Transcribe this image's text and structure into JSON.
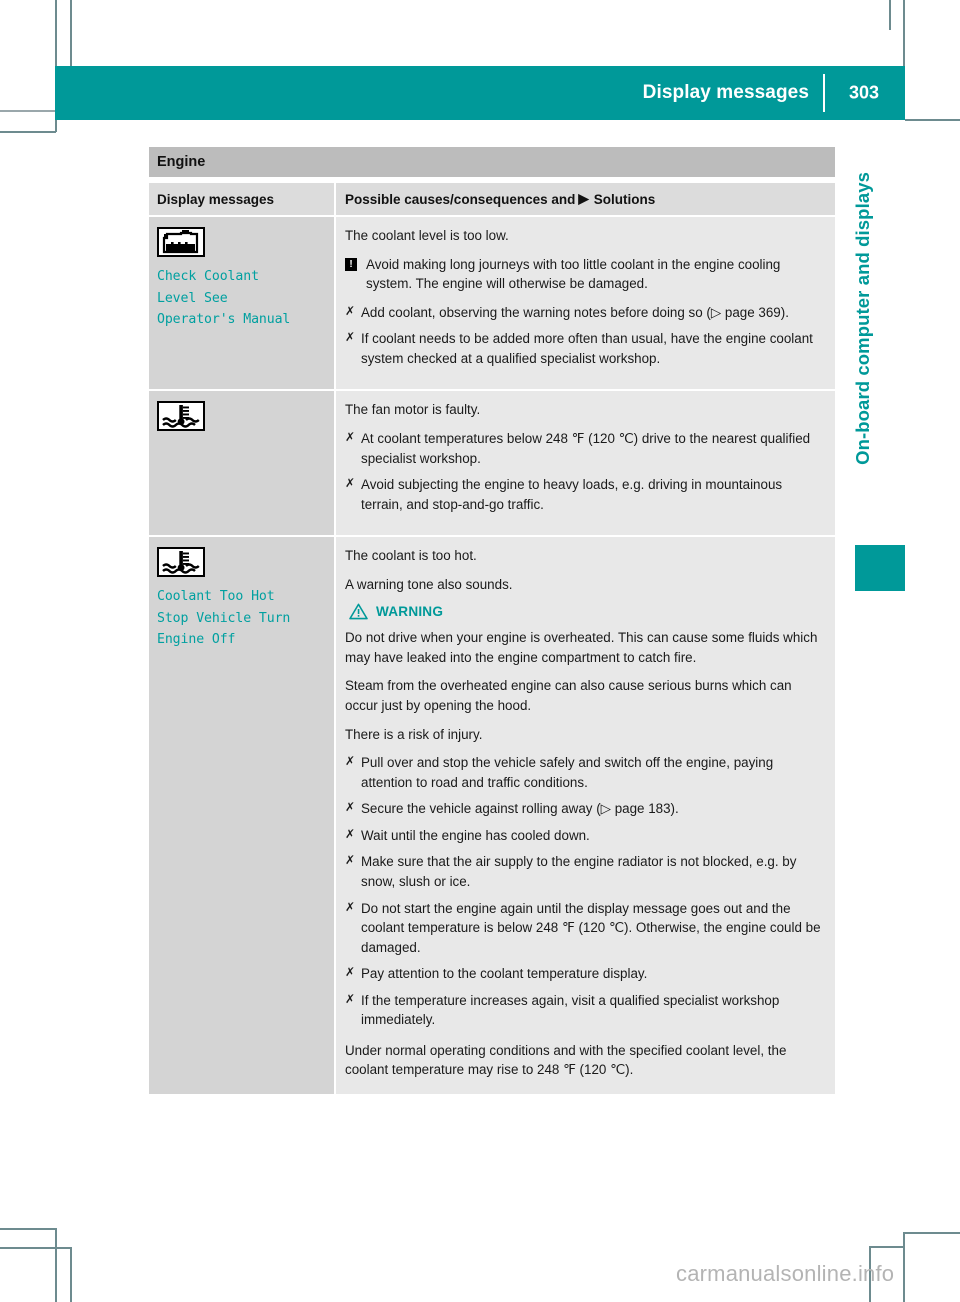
{
  "header": {
    "title": "Display messages",
    "page_number": "303"
  },
  "sidebar": {
    "chapter_label": "On-board computer and displays"
  },
  "table": {
    "section_title": "Engine",
    "columns": {
      "left": "Display messages",
      "right_before_marker": "Possible causes/consequences and",
      "right_marker": "▶",
      "right_after_marker": "Solutions"
    },
    "rows": [
      {
        "icon_name": "coolant-reservoir-icon",
        "message": "Check Coolant\nLevel See\nOperator's Manual",
        "content": [
          {
            "kind": "para",
            "text": "The coolant level is too low."
          },
          {
            "kind": "notice",
            "marker": "!",
            "text": "Avoid making long journeys with too little coolant in the engine cooling system. The engine will otherwise be damaged."
          },
          {
            "kind": "bullet",
            "marker": "✗",
            "text": "Add coolant, observing the warning notes before doing so (▷ page 369)."
          },
          {
            "kind": "bullet",
            "marker": "✗",
            "text": "If coolant needs to be added more often than usual, have the engine coolant system checked at a qualified specialist workshop."
          }
        ]
      },
      {
        "icon_name": "coolant-temperature-icon",
        "message": "",
        "content": [
          {
            "kind": "para",
            "text": "The fan motor is faulty."
          },
          {
            "kind": "bullet",
            "marker": "✗",
            "text": "At coolant temperatures below 248 ℉ (120 ℃) drive to the nearest qualified specialist workshop."
          },
          {
            "kind": "bullet",
            "marker": "✗",
            "text": "Avoid subjecting the engine to heavy loads, e.g. driving in mountainous terrain, and stop-and-go traffic."
          }
        ]
      },
      {
        "icon_name": "coolant-temperature-icon",
        "message": "Coolant Too Hot\nStop Vehicle Turn\nEngine Off",
        "content": [
          {
            "kind": "para",
            "text": "The coolant is too hot."
          },
          {
            "kind": "para",
            "text": "A warning tone also sounds."
          },
          {
            "kind": "warning-heading",
            "text": "WARNING"
          },
          {
            "kind": "para",
            "text": "Do not drive when your engine is overheated. This can cause some fluids which may have leaked into the engine compartment to catch fire."
          },
          {
            "kind": "para",
            "text": "Steam from the overheated engine can also cause serious burns which can occur just by opening the hood."
          },
          {
            "kind": "para",
            "text": "There is a risk of injury."
          },
          {
            "kind": "bullet",
            "marker": "✗",
            "text": "Pull over and stop the vehicle safely and switch off the engine, paying attention to road and traffic conditions."
          },
          {
            "kind": "bullet",
            "marker": "✗",
            "text": "Secure the vehicle against rolling away (▷ page 183)."
          },
          {
            "kind": "bullet",
            "marker": "✗",
            "text": "Wait until the engine has cooled down."
          },
          {
            "kind": "bullet",
            "marker": "✗",
            "text": "Make sure that the air supply to the engine radiator is not blocked, e.g. by snow, slush or ice."
          },
          {
            "kind": "bullet",
            "marker": "✗",
            "text": "Do not start the engine again until the display message goes out and the coolant temperature is below 248 ℉ (120 ℃). Otherwise, the engine could be damaged."
          },
          {
            "kind": "bullet",
            "marker": "✗",
            "text": "Pay attention to the coolant temperature display."
          },
          {
            "kind": "bullet",
            "marker": "✗",
            "text": "If the temperature increases again, visit a qualified specialist workshop immediately."
          },
          {
            "kind": "para",
            "text": "Under normal operating conditions and with the specified coolant level, the coolant temperature may rise to 248 ℉ (120 ℃)."
          }
        ]
      }
    ]
  },
  "watermark": {
    "text": "carmanualsonline.info"
  },
  "colors": {
    "teal": "#009999",
    "section_head_gray": "#bcbcbc",
    "col_head_gray": "#dcdcdc",
    "left_cell_gray": "#d4d4d4",
    "right_cell_gray": "#e8e8e8",
    "watermark_gray": "#b4b4b4"
  }
}
